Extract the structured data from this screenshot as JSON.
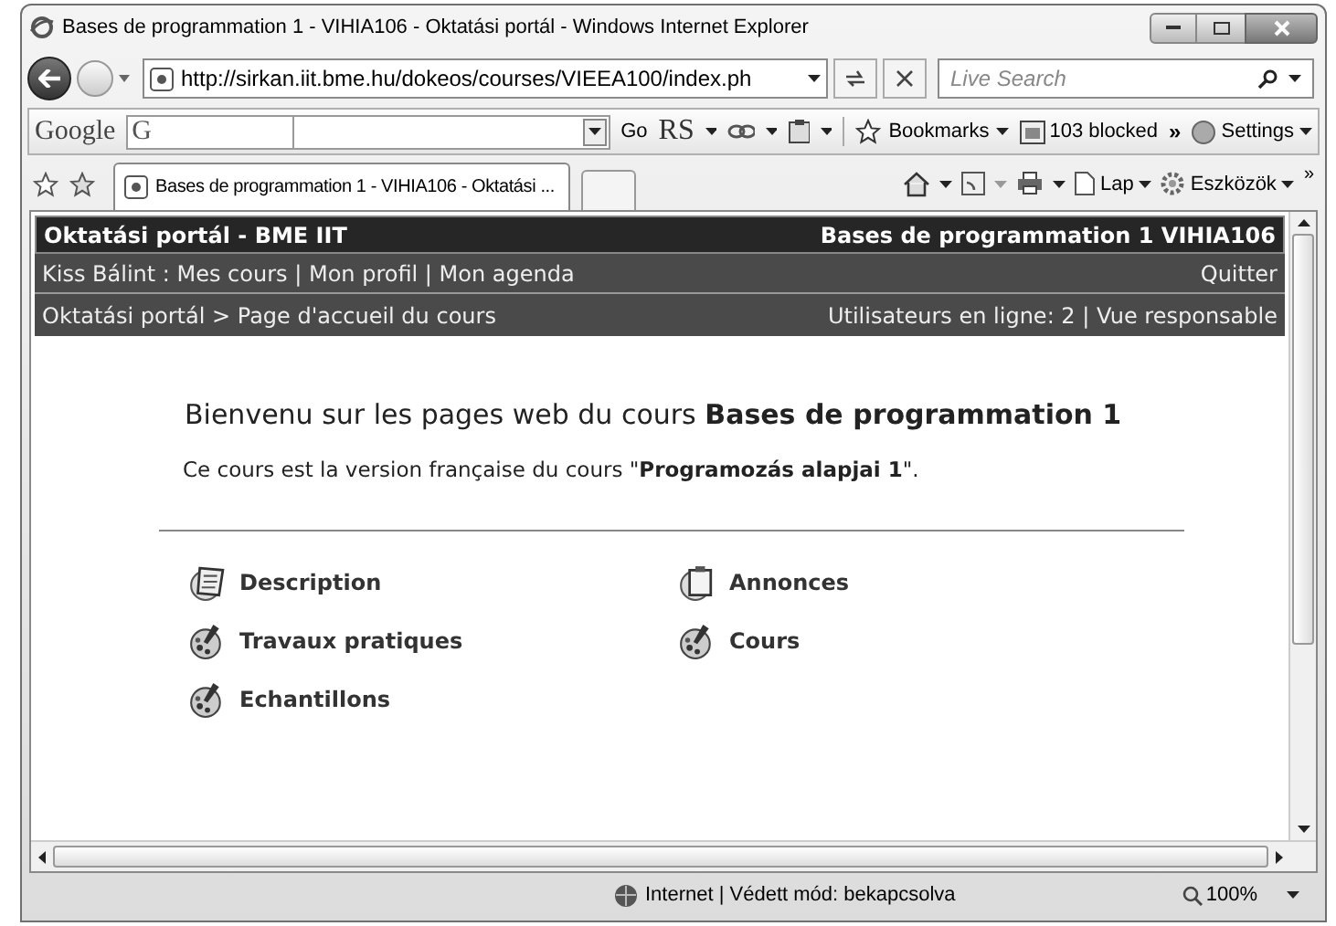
{
  "window": {
    "title": "Bases de programmation 1 - VIHIA106 - Oktatási portál - Windows Internet Explorer"
  },
  "address_bar": {
    "url": "http://sirkan.iit.bme.hu/dokeos/courses/VIEEA100/index.ph"
  },
  "search": {
    "placeholder": "Live Search"
  },
  "google_toolbar": {
    "logo": "Google",
    "g_menu": "G",
    "go": "Go",
    "rs": "RS",
    "bookmarks": "Bookmarks",
    "blocked": "103 blocked",
    "more": "»",
    "settings": "Settings"
  },
  "tabs": [
    {
      "label": "Bases de programmation 1 - VIHIA106 - Oktatási ...",
      "selected": true
    }
  ],
  "command_bar": {
    "page": "Lap",
    "tools": "Eszközök",
    "more": "»"
  },
  "page": {
    "header": {
      "left": "Oktatási portál - BME IIT",
      "right": "Bases de programmation 1 VIHIA106"
    },
    "user_menu": {
      "links": "Kiss Bálint : Mes cours | Mon profil | Mon agenda",
      "logout": "Quitter"
    },
    "breadcrumb": {
      "path": "Oktatási portál > Page d'accueil du cours",
      "info": "Utilisateurs en ligne: 2 | Vue responsable"
    },
    "heading": "Bienvenu sur les pages web du cours **Bases de programmation 1**",
    "intro": "Ce cours est la version française du cours \"**Programozás alapjai 1**\".",
    "tools": [
      {
        "label": "Description",
        "kind": "book"
      },
      {
        "label": "Annonces",
        "kind": "clipboard"
      },
      {
        "label": "Travaux pratiques",
        "kind": "palette"
      },
      {
        "label": "Cours",
        "kind": "palette"
      },
      {
        "label": "Echantillons",
        "kind": "palette"
      }
    ]
  },
  "status_bar": {
    "zone": "Internet | Védett mód: bekapcsolva",
    "zoom": "100%"
  }
}
